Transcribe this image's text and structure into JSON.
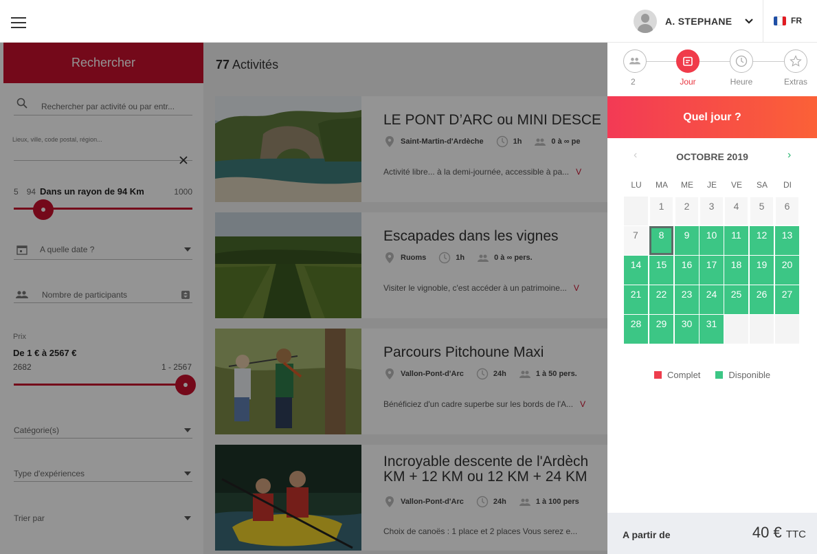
{
  "header": {
    "user_name": "A. STEPHANE",
    "language": "FR",
    "flag_colors": [
      "#1f4fa5",
      "#ffffff",
      "#e11b22"
    ]
  },
  "sidebar": {
    "search_button": "Rechercher",
    "search_placeholder": "Rechercher par activité ou par entr...",
    "location_placeholder": "Lieux, ville, code postal, région...",
    "radius_min": "5",
    "radius_value": "94",
    "radius_label": "Dans un rayon de 94 Km",
    "radius_max": "1000",
    "radius_fraction": 0.09,
    "date_placeholder": "A quelle date ?",
    "participants_placeholder": "Nombre de participants",
    "price_label": "Prix",
    "price_range_text": "De 1 € à 2567 €",
    "price_max_number": "2682",
    "price_range_short": "1 - 2567",
    "price_fraction": 0.96,
    "category_placeholder": "Catégorie(s)",
    "experience_placeholder": "Type d'expériences",
    "sort_placeholder": "Trier par"
  },
  "results": {
    "count": "77",
    "count_label": "Activités",
    "cards": [
      {
        "title": "LE PONT D’ARC ou MINI DESCE",
        "location": "Saint-Martin-d'Ardèche",
        "duration": "1h",
        "people": "0 à ∞ pe",
        "description": "Activité libre... à la demi-journée, accessible à pa...",
        "more": "V"
      },
      {
        "title": "Escapades dans les vignes",
        "location": "Ruoms",
        "duration": "1h",
        "people": "0 à ∞ pers.",
        "description": "Visiter le vignoble, c'est accéder à un patrimoine...",
        "more": "V"
      },
      {
        "title": "Parcours Pitchoune Maxi",
        "location": "Vallon-Pont-d'Arc",
        "duration": "24h",
        "people": "1 à 50 pers.",
        "description": "Bénéficiez d'un cadre superbe sur les bords de l'A...",
        "more": "V"
      },
      {
        "title": "Incroyable descente de l'Ardèch",
        "title2": "KM + 12 KM ou 12 KM + 24 KM",
        "location": "Vallon-Pont-d'Arc",
        "duration": "24h",
        "people": "1 à 100 pers",
        "description": "Choix de canoës : 1 place et 2 places Vous serez e..."
      }
    ]
  },
  "booking": {
    "steps": [
      {
        "label": "2"
      },
      {
        "label": "Jour"
      },
      {
        "label": "Heure"
      },
      {
        "label": "Extras"
      }
    ],
    "question": "Quel jour ?",
    "month": "OCTOBRE 2019",
    "prev": "‹",
    "next": "›",
    "weekdays": [
      "LU",
      "MA",
      "ME",
      "JE",
      "VE",
      "SA",
      "DI"
    ],
    "legend_full": "Complet",
    "legend_available": "Disponible",
    "color_full": "#ee3d4d",
    "color_available": "#3cc685",
    "price_label": "A partir de",
    "price_value": "40 €",
    "price_suffix": "TTC"
  }
}
